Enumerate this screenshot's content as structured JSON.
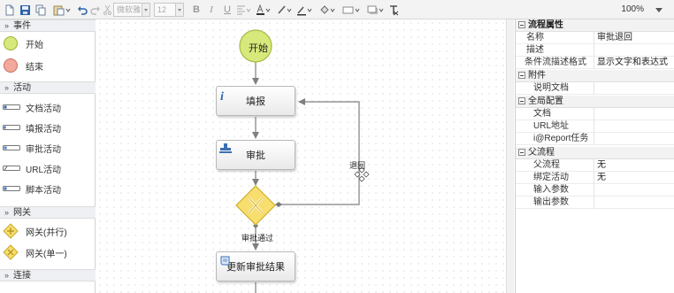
{
  "toolbar": {
    "font_name": "微软雅",
    "font_size": "12",
    "zoom": "100%"
  },
  "palette": {
    "sections": [
      {
        "title": "事件",
        "items": [
          "开始",
          "结束"
        ]
      },
      {
        "title": "活动",
        "items": [
          "文档活动",
          "填报活动",
          "审批活动",
          "URL活动",
          "脚本活动"
        ]
      },
      {
        "title": "网关",
        "items": [
          "网关(并行)",
          "网关(单一)"
        ]
      },
      {
        "title": "连接",
        "items": []
      }
    ]
  },
  "diagram": {
    "start_label": "开始",
    "tasks": [
      "填报",
      "审批",
      "更新审批结果"
    ],
    "edge_labels": {
      "reject": "退回",
      "approved": "审批通过"
    }
  },
  "props": {
    "header": "流程属性",
    "rows_top": [
      {
        "key": "名称",
        "value": "审批退回"
      },
      {
        "key": "描述",
        "value": ""
      },
      {
        "key": "条件流描述格式",
        "value": "显示文字和表达式"
      }
    ],
    "group_attach": "附件",
    "rows_attach": [
      {
        "key": "说明文档",
        "value": ""
      }
    ],
    "group_global": "全局配置",
    "rows_global": [
      {
        "key": "文档",
        "value": ""
      },
      {
        "key": "URL地址",
        "value": ""
      },
      {
        "key": "i@Report任务",
        "value": ""
      }
    ],
    "group_parent": "父流程",
    "rows_parent": [
      {
        "key": "父流程",
        "value": "无"
      },
      {
        "key": "绑定活动",
        "value": "无"
      },
      {
        "key": "输入参数",
        "value": ""
      },
      {
        "key": "输出参数",
        "value": ""
      }
    ]
  },
  "colors": {
    "start_fill": "#d7e97a",
    "end_fill": "#f4a89b",
    "gateway_fill": "#f7de6e",
    "edge": "#7f7f7f"
  }
}
